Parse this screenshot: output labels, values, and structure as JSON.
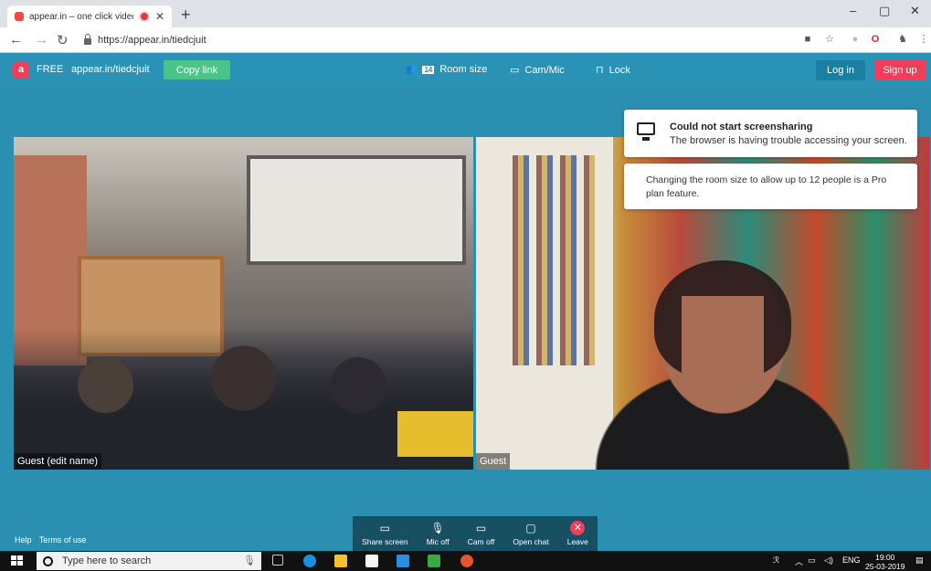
{
  "browser": {
    "tab_title": "appear.in – one click video c",
    "url": "https://appear.in/tiedcjuit",
    "new_tab": "+",
    "minimize": "–",
    "restore": "▢",
    "close": "✕"
  },
  "header": {
    "logo": "a",
    "plan": "FREE",
    "room_url": "appear.in/tiedcjuit",
    "copy_link": "Copy link",
    "room_size": "Room size",
    "room_size_badge": "14",
    "cam_mic": "Cam/Mic",
    "lock": "Lock",
    "log_in": "Log in",
    "sign_up": "Sign up"
  },
  "notifications": {
    "screenshare_title": "Could not start screensharing",
    "screenshare_body": "The browser is having trouble accessing your screen.",
    "room_size_message": "Changing the room size to allow up to 12 people is a Pro plan feature."
  },
  "videos": {
    "left_name": "Guest (edit name)",
    "right_name": "Guest"
  },
  "footer": {
    "help": "Help",
    "terms": "Terms of use"
  },
  "controls": {
    "share_screen": "Share screen",
    "mic_off": "Mic off",
    "cam_off": "Cam off",
    "open_chat": "Open chat",
    "leave": "Leave"
  },
  "taskbar": {
    "search_placeholder": "Type here to search",
    "language": "ENG",
    "time": "19:00",
    "date": "25-03-2019"
  },
  "colors": {
    "app_bg": "#2a8fb1",
    "header_bg": "#2a93b5",
    "copy_button": "#4bc487",
    "sign_up": "#ef3d5a",
    "control_bar": "#174f63"
  }
}
